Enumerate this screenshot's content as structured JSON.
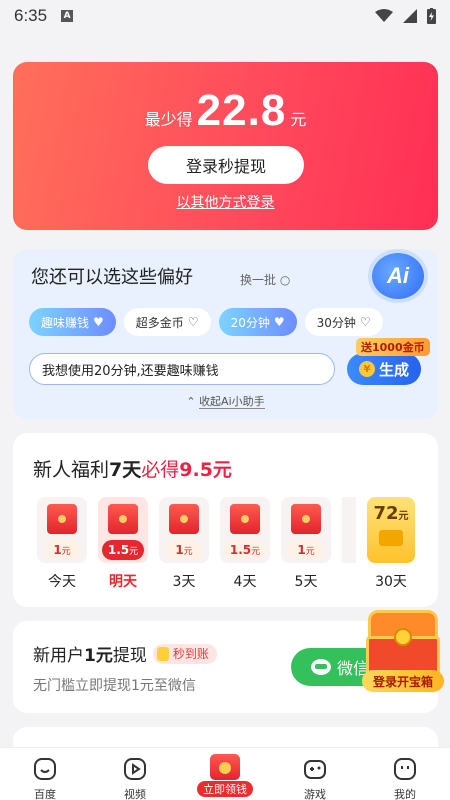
{
  "status_bar": {
    "time": "6:35",
    "indicator": "A"
  },
  "hero": {
    "prefix": "最少得",
    "amount": "22.8",
    "suffix": "元",
    "login_button": "登录秒提现",
    "alt_login": "以其他方式登录"
  },
  "ai": {
    "title": "您还可以选这些偏好",
    "refresh": "换一批",
    "badge": "Ai",
    "chips": [
      {
        "label": "趣味赚钱",
        "active": true
      },
      {
        "label": "超多金币",
        "active": false
      },
      {
        "label": "20分钟",
        "active": true
      },
      {
        "label": "30分钟",
        "active": false
      }
    ],
    "input_value": "我想使用20分钟,还要趣味赚钱",
    "generate_button": "生成",
    "generate_tag": "送1000金币",
    "collapse": "收起Ai小助手"
  },
  "newbie": {
    "title_prefix": "新人福利",
    "title_days": "7天",
    "title_must": "必得",
    "title_amount": "9.5元",
    "days": [
      {
        "amount": "1",
        "unit": "元",
        "label": "今天"
      },
      {
        "amount": "1.5",
        "unit": "元",
        "label": "明天"
      },
      {
        "amount": "1",
        "unit": "元",
        "label": "3天"
      },
      {
        "amount": "1.5",
        "unit": "元",
        "label": "4天"
      },
      {
        "amount": "1",
        "unit": "元",
        "label": "5天"
      }
    ],
    "big_reward": {
      "amount": "72",
      "unit": "元",
      "label": "30天"
    }
  },
  "withdraw": {
    "title_prefix": "新用户",
    "title_bold": "1元",
    "title_suffix": "提现",
    "badge": "秒到账",
    "subtitle": "无门槛立即提现1元至微信",
    "button": "微信"
  },
  "treasure": {
    "label": "登录开宝箱"
  },
  "bottom_nav": {
    "items": [
      {
        "label": "百度"
      },
      {
        "label": "视频"
      },
      {
        "label": "立即领钱"
      },
      {
        "label": "游戏"
      },
      {
        "label": "我的"
      }
    ]
  },
  "colors": {
    "hero_gradient_start": "#ff6f5a",
    "hero_gradient_end": "#ff2f55",
    "accent_red": "#e8262f",
    "wechat_green": "#34c15b",
    "ai_blue": "#2e6cf6"
  }
}
